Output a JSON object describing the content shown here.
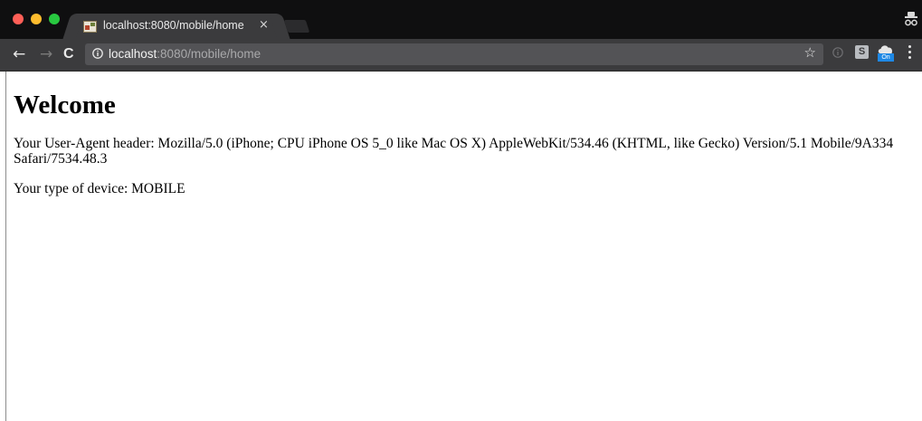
{
  "browser": {
    "tab": {
      "title": "localhost:8080/mobile/home",
      "close_glyph": "×",
      "favicon": "page-favicon"
    },
    "toolbar": {
      "back_glyph": "←",
      "forward_glyph": "→",
      "reload_glyph": "C",
      "url_host": "localhost",
      "url_rest": ":8080/mobile/home",
      "bookmark_glyph": "☆",
      "extensions": [
        {
          "name": "info-icon"
        },
        {
          "name": "s-extension",
          "label": "S"
        },
        {
          "name": "on-extension",
          "label": "On"
        }
      ]
    },
    "colors": {
      "traffic_close": "#ff5f57",
      "traffic_min": "#febc2e",
      "traffic_max": "#28c840",
      "chrome_dark": "#0f0f10",
      "toolbar": "#3b3b3d",
      "omnibox": "#535356"
    }
  },
  "page": {
    "heading": "Welcome",
    "user_agent_line": "Your User-Agent header: Mozilla/5.0 (iPhone; CPU iPhone OS 5_0 like Mac OS X) AppleWebKit/534.46 (KHTML, like Gecko) Version/5.1 Mobile/9A334 Safari/7534.48.3",
    "device_line": "Your type of device: MOBILE"
  }
}
